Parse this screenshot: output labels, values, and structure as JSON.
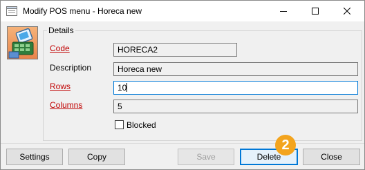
{
  "window": {
    "title": "Modify POS menu - Horeca new",
    "icon": "pos-menu-app-icon",
    "controls": [
      "minimize-icon",
      "maximize-icon",
      "close-icon"
    ]
  },
  "details": {
    "legend": "Details",
    "logo": "pos-register-icon",
    "fields": [
      {
        "key": "code",
        "label": "Code",
        "required": true,
        "value": "HORECA2"
      },
      {
        "key": "description",
        "label": "Description",
        "required": false,
        "value": "Horeca new"
      },
      {
        "key": "rows",
        "label": "Rows",
        "required": true,
        "value": "10",
        "focused": true
      },
      {
        "key": "columns",
        "label": "Columns",
        "required": true,
        "value": "5"
      }
    ],
    "blocked": {
      "label": "Blocked",
      "checked": false
    }
  },
  "buttons": {
    "settings": "Settings",
    "copy": "Copy",
    "save": "Save",
    "delete": "Delete",
    "close": "Close"
  },
  "annotation": {
    "step_badge": "2"
  },
  "colors": {
    "required_label": "#c00000",
    "focus_border": "#0078d7",
    "badge": "#f3a41e"
  }
}
